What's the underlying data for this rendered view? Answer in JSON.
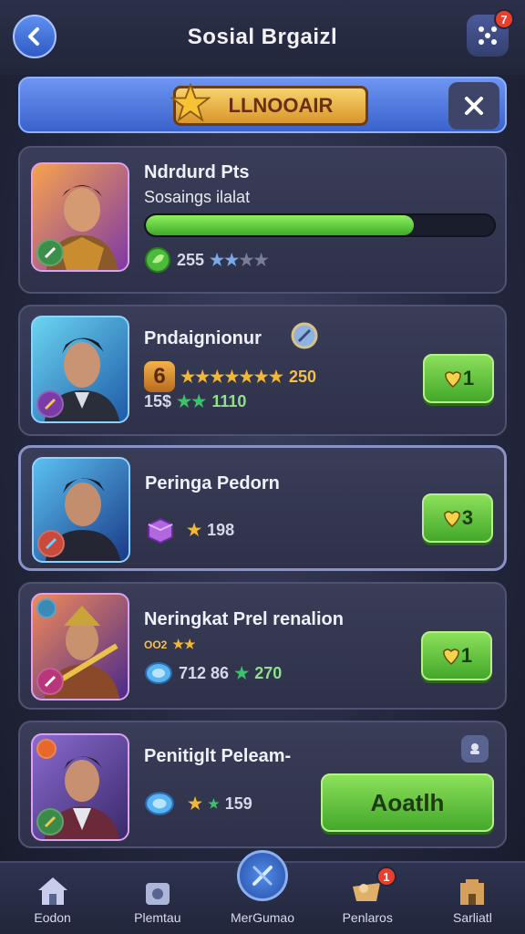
{
  "header": {
    "title": "Sosial Brgaizl",
    "notification_count": "7"
  },
  "banner": {
    "badge_text": "LLNOOAIR"
  },
  "cards": [
    {
      "name": "Ndrdurd Pts",
      "subtitle": "Sosaings ilalat",
      "progress": 0.77,
      "stat_value": "255"
    },
    {
      "name": "Pndaignionur",
      "rank_number": "6",
      "score": "250",
      "stat_a": "15$",
      "stat_b": "1110",
      "button_label": "1"
    },
    {
      "name": "Peringa Pedorn",
      "stat_value": "198",
      "button_label": "3"
    },
    {
      "name": "Neringkat Prel renalion",
      "small_text": "OO2",
      "stat_a": "712 86",
      "stat_b": "270",
      "button_label": "1"
    },
    {
      "name": "Penitiglt Peleam-",
      "stat_value": "159",
      "button_label": "Aoatlh"
    }
  ],
  "nav": [
    {
      "label": "Eodon"
    },
    {
      "label": "Plemtau"
    },
    {
      "label": "MerGumao"
    },
    {
      "label": "Penlaros",
      "badge": "1"
    },
    {
      "label": "Sarliatl"
    }
  ],
  "colors": {
    "accent_green": "#43a82a",
    "accent_blue": "#3a62cc",
    "badge_red": "#e8402c"
  }
}
